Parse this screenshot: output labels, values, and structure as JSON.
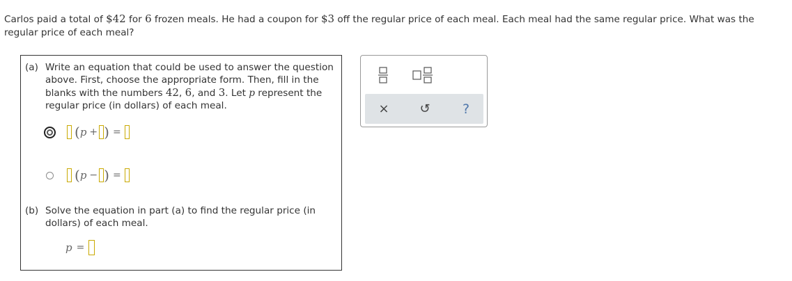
{
  "problem": {
    "text_1": "Carlos paid a total of ",
    "total": "$42",
    "text_2": " for ",
    "count": "6",
    "text_3": " frozen meals. He had a coupon for ",
    "discount": "$3",
    "text_4": " off the regular price of each meal. Each meal had the same regular price. What was the regular price of each meal?"
  },
  "part_a": {
    "tag": "(a)",
    "text_1": "Write an equation that could be used to answer the question above. First, choose the appropriate form. Then, fill in the blanks with the numbers ",
    "n1": "42",
    "sep1": ", ",
    "n2": "6",
    "sep2": ", and ",
    "n3": "3",
    "text_2": ". Let ",
    "var": "p",
    "text_3": " represent the regular price (in dollars) of each meal.",
    "options": [
      {
        "open": "(",
        "var": "p",
        "op": "+",
        "close": ")",
        "eq": "=",
        "selected": true
      },
      {
        "open": "(",
        "var": "p",
        "op": "−",
        "close": ")",
        "eq": "=",
        "selected": false
      }
    ]
  },
  "part_b": {
    "tag": "(b)",
    "text": "Solve the equation in part (a) to find the regular price (in dollars) of each meal.",
    "var": "p",
    "eq": "="
  },
  "toolbar": {
    "icons": [
      "fraction-icon",
      "mixed-number-icon"
    ],
    "actions": {
      "clear": "×",
      "undo": "↺",
      "help": "?"
    }
  }
}
